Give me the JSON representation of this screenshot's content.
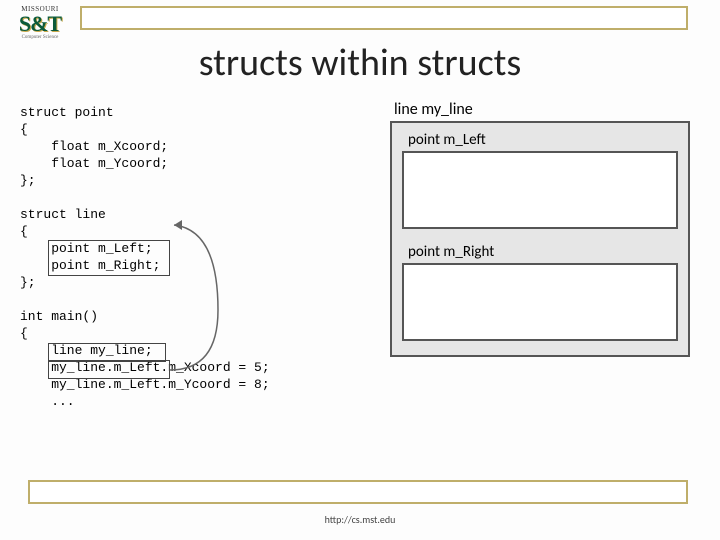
{
  "logo": {
    "state": "MISSOURI",
    "st": "S&T",
    "sub": "Computer Science"
  },
  "title": "structs within structs",
  "code": "struct point\n{\n    float m_Xcoord;\n    float m_Ycoord;\n};\n\nstruct line\n{\n    point m_Left;\n    point m_Right;\n};\n\nint main()\n{\n    line my_line;\n    my_line.m_Left.m_Xcoord = 5;\n    my_line.m_Left.m_Ycoord = 8;\n    ...",
  "diagram": {
    "outer_label": "line my_line",
    "box1_label": "point m_Left",
    "box2_label": "point m_Right"
  },
  "footer": "http://cs.mst.edu"
}
